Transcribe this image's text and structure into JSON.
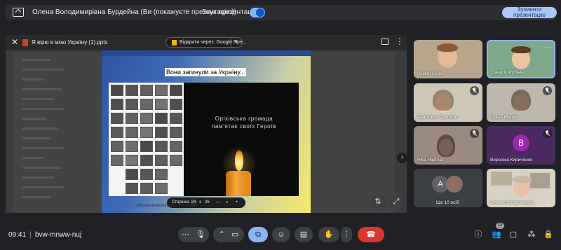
{
  "topbar": {
    "presenter": "Олена Володимирівна Бурдейна (Ви (покажуєте презентацію))",
    "sound_label": "Звук презентації",
    "sound_on": true,
    "stop_button": "Зупинити презентацію"
  },
  "viewer": {
    "file_name": "Я вірю в мою Україну (1).pptx",
    "open_with": "Відкрити через: Google Пре...",
    "slide": {
      "title": "Вони загинули за Україну...",
      "memorial_line1": "Оріхівська громада",
      "memorial_line2": "пам'ятає своїх Героїв",
      "link": "chrome-extension://...ct.html"
    },
    "pager": {
      "label": "Сторінка",
      "current": "24",
      "of": "з",
      "total": "26"
    }
  },
  "participants": [
    {
      "name": "Роман Коба",
      "muted": false
    },
    {
      "name": "Данило Рубінін",
      "muted": false
    },
    {
      "name": "Анастасія Сиволап",
      "muted": true
    },
    {
      "name": "Ольга Марич",
      "muted": true
    },
    {
      "name": "Ніка Нікітіна",
      "muted": true
    },
    {
      "name": "Вероніка Кириченко",
      "muted": true,
      "initial": "В",
      "avatar_color": "#9c27b0"
    },
    {
      "name": "Ще 10 осіб",
      "muted": false,
      "initial": "А"
    },
    {
      "name": "Олена Володимирів...",
      "muted": false
    }
  ],
  "bottom": {
    "time": "09:41",
    "separator": "|",
    "meeting_code": "bvw-mnww-nuj",
    "participant_count": "18"
  },
  "colors": {
    "accent": "#8ab4f8",
    "end_call": "#dc362e",
    "background": "#202124"
  }
}
